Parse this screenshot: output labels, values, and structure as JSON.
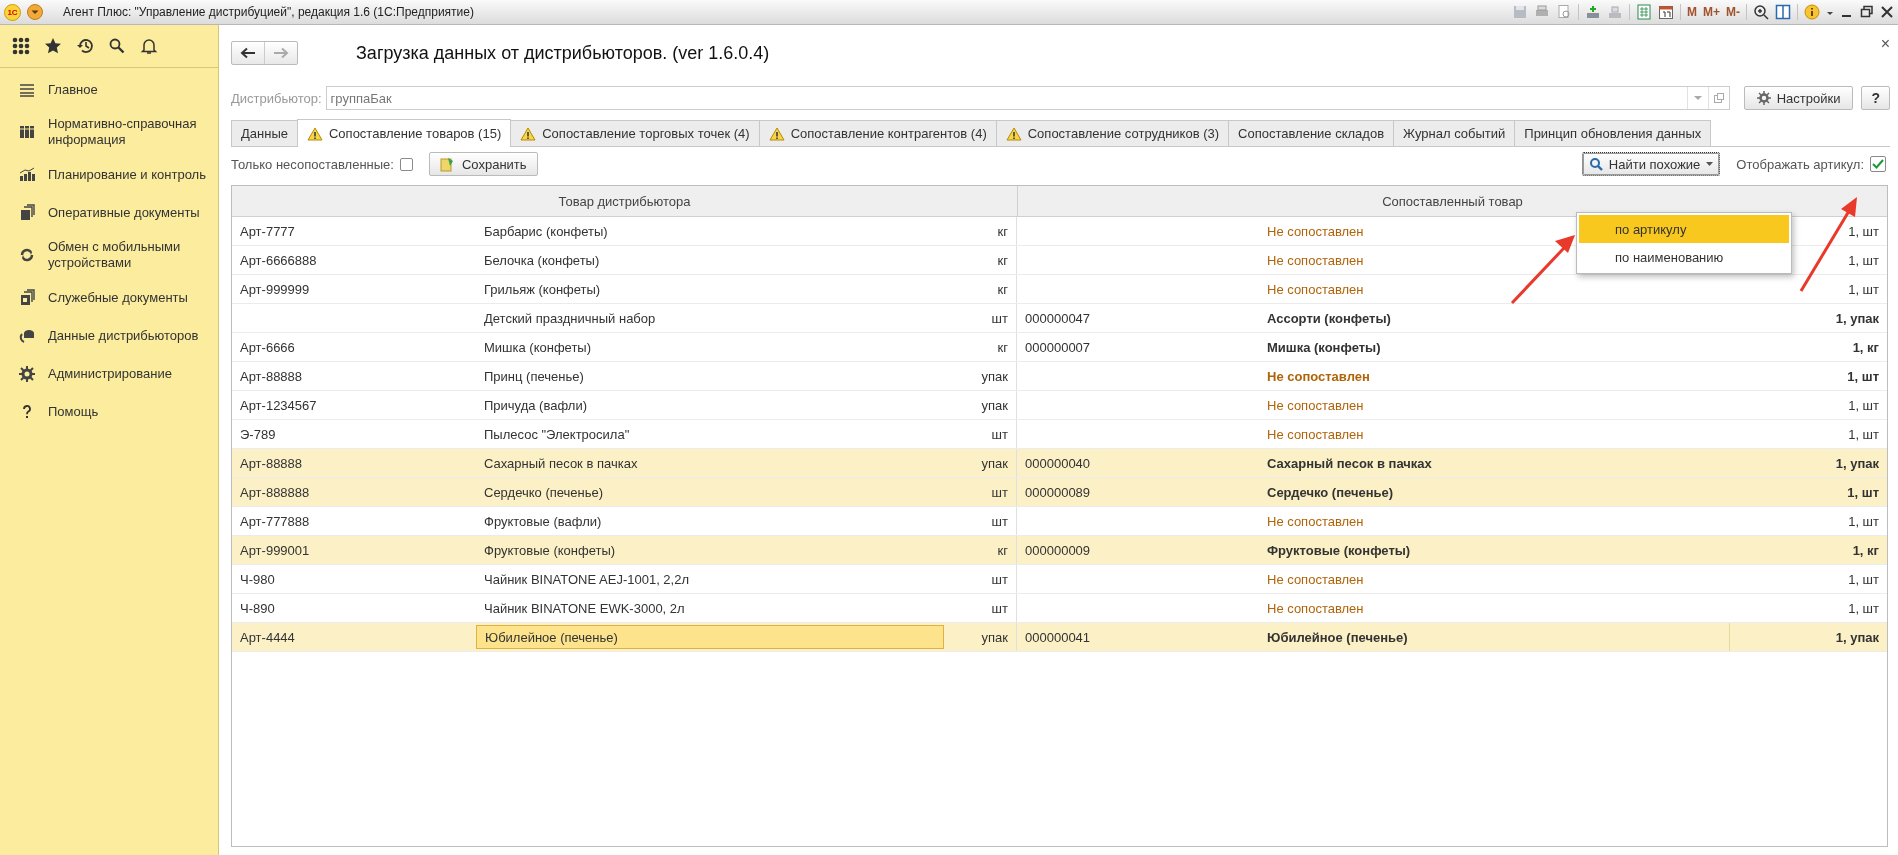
{
  "title_bar": {
    "logo": "1С",
    "title": "Агент Плюс: \"Управление дистрибуцией\", редакция 1.6  (1С:Предприятие)",
    "memory_buttons": [
      "M",
      "M+",
      "M-"
    ]
  },
  "sidebar": {
    "items": [
      {
        "label": "Главное"
      },
      {
        "label": "Нормативно-справочная информация"
      },
      {
        "label": "Планирование и контроль"
      },
      {
        "label": "Оперативные документы"
      },
      {
        "label": "Обмен с мобильными устройствами"
      },
      {
        "label": "Служебные документы"
      },
      {
        "label": "Данные дистрибьюторов"
      },
      {
        "label": "Администрирование"
      },
      {
        "label": "Помощь"
      }
    ]
  },
  "form": {
    "title": "Загрузка данных от дистрибьюторов. (ver 1.6.0.4)",
    "close": "×",
    "distributor": {
      "label": "Дистрибьютор:",
      "value": "группаБак"
    },
    "settings_button": "Настройки",
    "help_button": "?",
    "tabs": [
      {
        "label": "Данные",
        "warning": false,
        "selected": false
      },
      {
        "label": "Сопоставление товаров (15)",
        "warning": true,
        "selected": true
      },
      {
        "label": "Сопоставление торговых точек (4)",
        "warning": true,
        "selected": false
      },
      {
        "label": "Сопоставление контрагентов (4)",
        "warning": true,
        "selected": false
      },
      {
        "label": "Сопоставление сотрудников (3)",
        "warning": true,
        "selected": false
      },
      {
        "label": "Сопоставление складов",
        "warning": false,
        "selected": false
      },
      {
        "label": "Журнал событий",
        "warning": false,
        "selected": false
      },
      {
        "label": "Принцип обновления данных",
        "warning": false,
        "selected": false
      }
    ],
    "toolbar": {
      "only_unmatched": {
        "label": "Только несопоставленные:",
        "checked": false
      },
      "save_button": "Сохранить",
      "find_button": "Найти похожие",
      "find_menu": [
        {
          "label": "по артикулу",
          "selected": true
        },
        {
          "label": "по наименованию",
          "selected": false
        }
      ],
      "show_article": {
        "label": "Отображать артикул:",
        "checked": true
      }
    },
    "table": {
      "columns": [
        "Товар дистрибьютора",
        "Сопоставленный товар"
      ],
      "rows": [
        {
          "article": "Арт-7777",
          "name": "Барбарис (конфеты)",
          "unit": "кг",
          "matched": "Не сопоставлен",
          "qty": "1, шт",
          "is_matched": false,
          "bold": false,
          "highlighted": false,
          "selected": false
        },
        {
          "article": "Арт-6666888",
          "name": "Белочка (конфеты)",
          "unit": "кг",
          "matched": "Не сопоставлен",
          "qty": "1, шт",
          "is_matched": false,
          "bold": false,
          "highlighted": false,
          "selected": false
        },
        {
          "article": "Арт-999999",
          "name": "Грильяж (конфеты)",
          "unit": "кг",
          "matched": "Не сопоставлен",
          "qty": "1, шт",
          "is_matched": false,
          "bold": false,
          "highlighted": false,
          "selected": false
        },
        {
          "name": "Детский праздничный набор",
          "unit": "шт",
          "code": "000000047",
          "matched": "Ассорти (конфеты)",
          "qty": "1, упак",
          "is_matched": true,
          "bold": true,
          "highlighted": false,
          "selected": false
        },
        {
          "article": "Арт-6666",
          "name": "Мишка (конфеты)",
          "unit": "кг",
          "code": "000000007",
          "matched": "Мишка (конфеты)",
          "qty": "1, кг",
          "is_matched": true,
          "bold": true,
          "highlighted": false,
          "selected": false
        },
        {
          "article": "Арт-88888",
          "name": "Принц (печенье)",
          "unit": "упак",
          "matched": "Не сопоставлен",
          "qty": "1, шт",
          "is_matched": false,
          "bold": true,
          "highlighted": false,
          "selected": false
        },
        {
          "article": "Арт-1234567",
          "name": "Причуда (вафли)",
          "unit": "упак",
          "matched": "Не сопоставлен",
          "qty": "1, шт",
          "is_matched": false,
          "bold": false,
          "highlighted": false,
          "selected": false
        },
        {
          "article": "Э-789",
          "name": "Пылесос \"Электросила\"",
          "unit": "шт",
          "matched": "Не сопоставлен",
          "qty": "1, шт",
          "is_matched": false,
          "bold": false,
          "highlighted": false,
          "selected": false
        },
        {
          "article": "Арт-88888",
          "name": "Сахарный песок в пачках",
          "unit": "упак",
          "code": "000000040",
          "matched": "Сахарный песок в пачках",
          "qty": "1, упак",
          "is_matched": true,
          "bold": true,
          "highlighted": true,
          "selected": false
        },
        {
          "article": "Арт-888888",
          "name": "Сердечко (печенье)",
          "unit": "шт",
          "code": "000000089",
          "matched": "Сердечко (печенье)",
          "qty": "1, шт",
          "is_matched": true,
          "bold": true,
          "highlighted": true,
          "selected": false
        },
        {
          "article": "Арт-777888",
          "name": "Фруктовые (вафли)",
          "unit": "шт",
          "matched": "Не сопоставлен",
          "qty": "1, шт",
          "is_matched": false,
          "bold": false,
          "highlighted": false,
          "selected": false
        },
        {
          "article": "Арт-999001",
          "name": "Фруктовые (конфеты)",
          "unit": "кг",
          "code": "000000009",
          "matched": "Фруктовые (конфеты)",
          "qty": "1, кг",
          "is_matched": true,
          "bold": true,
          "highlighted": true,
          "selected": false
        },
        {
          "article": "Ч-980",
          "name": "Чайник BINATONE  AEJ-1001,  2,2л",
          "unit": "шт",
          "matched": "Не сопоставлен",
          "qty": "1, шт",
          "is_matched": false,
          "bold": false,
          "highlighted": false,
          "selected": false
        },
        {
          "article": "Ч-890",
          "name": "Чайник BINATONE  EWK-3000,  2л",
          "unit": "шт",
          "matched": "Не сопоставлен",
          "qty": "1, шт",
          "is_matched": false,
          "bold": false,
          "highlighted": false,
          "selected": false
        },
        {
          "article": "Арт-4444",
          "name": "Юбилейное (печенье)",
          "unit": "упак",
          "code": "000000041",
          "matched": "Юбилейное (печенье)",
          "qty": "1, упак",
          "is_matched": true,
          "bold": true,
          "highlighted": true,
          "selected": true
        }
      ]
    }
  }
}
